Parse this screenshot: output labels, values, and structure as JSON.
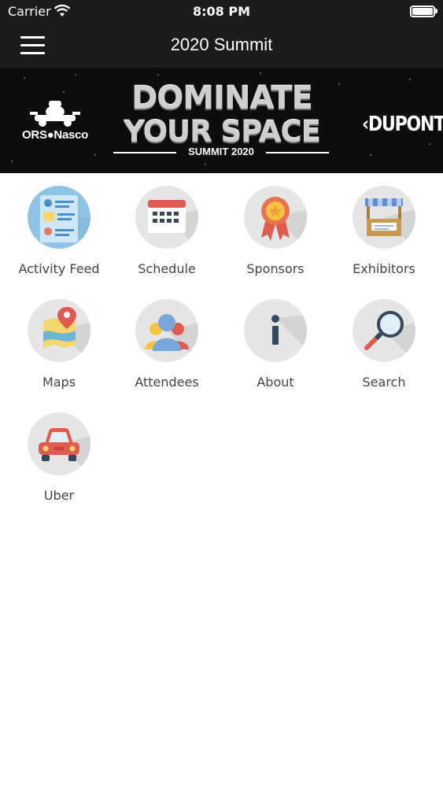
{
  "status_bar": {
    "carrier": "Carrier",
    "time": "8:08 PM",
    "battery_level": 1.0
  },
  "nav": {
    "title": "2020 Summit",
    "menu_icon": "hamburger-menu-icon"
  },
  "banner": {
    "left_logo": "ORS●Nasco",
    "headline_line1": "DOMINATE",
    "headline_line2": "YOUR SPACE",
    "subline": "SUMMIT 2020",
    "right_logo": "‹DUPONT›"
  },
  "tiles": [
    {
      "label": "Activity Feed",
      "icon": "activity-feed-icon"
    },
    {
      "label": "Schedule",
      "icon": "calendar-icon"
    },
    {
      "label": "Sponsors",
      "icon": "ribbon-award-icon"
    },
    {
      "label": "Exhibitors",
      "icon": "booth-icon"
    },
    {
      "label": "Maps",
      "icon": "map-pin-icon"
    },
    {
      "label": "Attendees",
      "icon": "people-icon"
    },
    {
      "label": "About",
      "icon": "info-icon"
    },
    {
      "label": "Search",
      "icon": "magnifier-icon"
    },
    {
      "label": "Uber",
      "icon": "car-icon"
    }
  ],
  "colors": {
    "bar_background": "#1b1b1b",
    "icon_circle": "#e6e6e6",
    "label_text": "#444444"
  }
}
